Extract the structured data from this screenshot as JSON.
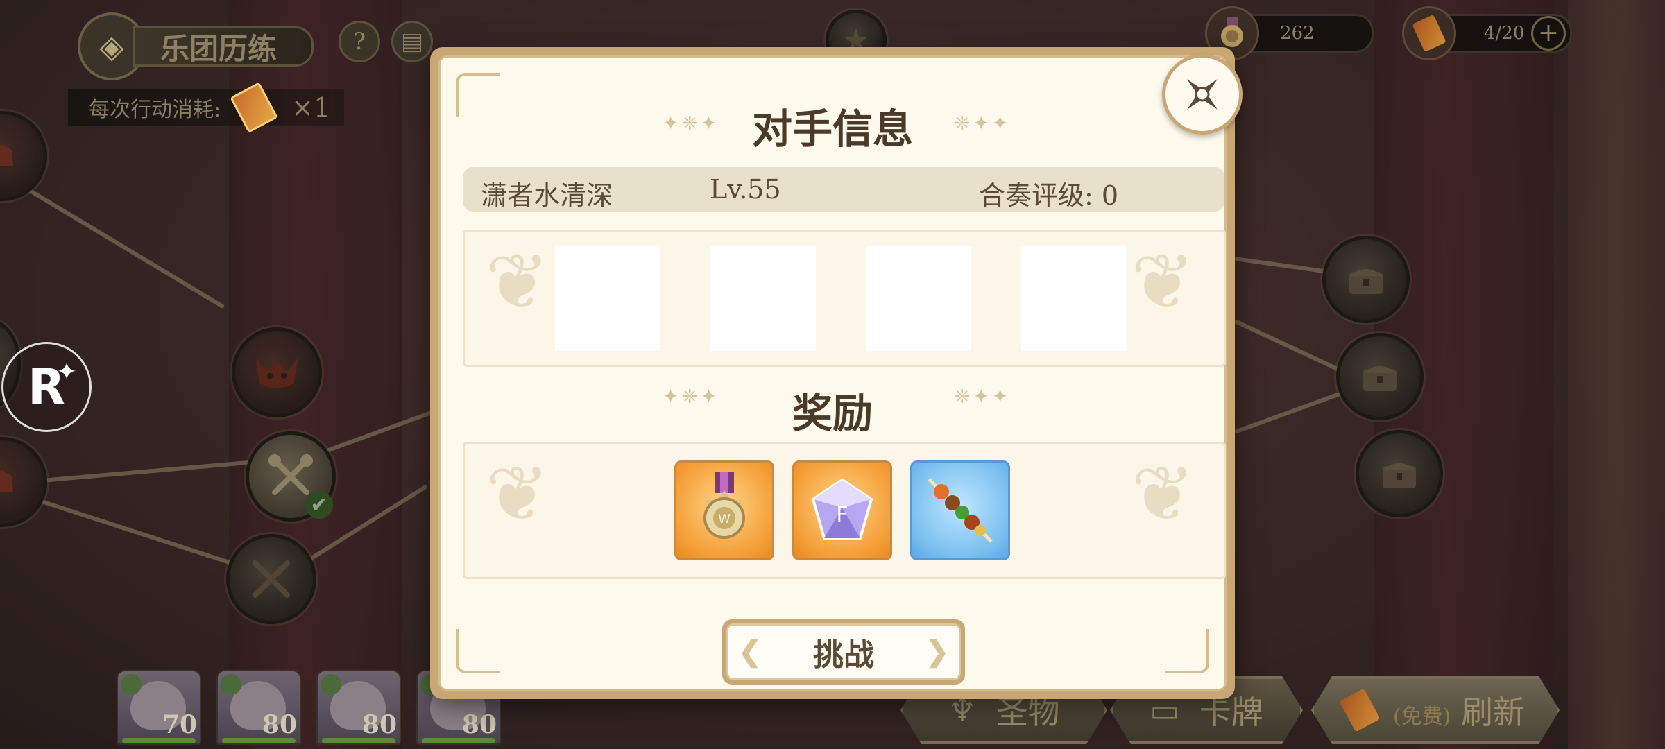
{
  "hud": {
    "title": "乐团历练",
    "cost_label": "每次行动消耗:",
    "cost_amount": "×1",
    "resource1": "262",
    "resource2": "4/20",
    "plus": "+"
  },
  "modal": {
    "title": "对手信息",
    "opponent": {
      "name": "潇者水清深",
      "level": "Lv.55",
      "rating": "合奏评级: 0"
    },
    "reward_title": "奖励",
    "rewards": [
      {
        "icon": "medal-icon",
        "bg": "orange"
      },
      {
        "icon": "crystal-icon",
        "bg": "orange"
      },
      {
        "icon": "skewer-icon",
        "bg": "blue"
      }
    ],
    "challenge_label": "挑战"
  },
  "team": [
    {
      "level": "70"
    },
    {
      "level": "80"
    },
    {
      "level": "80"
    },
    {
      "level": "80"
    }
  ],
  "bottom_buttons": {
    "relic": "圣物",
    "cards": "卡牌",
    "refresh_free": "(免费)",
    "refresh": "刷新"
  },
  "colors": {
    "accent_gold": "#c9a774",
    "panel_bg": "#fdf9ec",
    "text_dark": "#4a3a2a"
  }
}
